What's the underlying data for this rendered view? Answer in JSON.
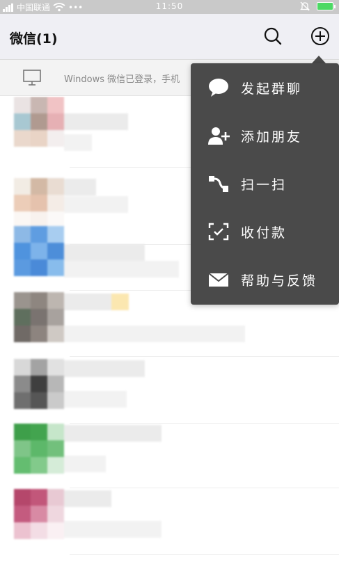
{
  "status_bar": {
    "carrier": "中国联通",
    "time": "11:50"
  },
  "header": {
    "title": "微信(1)"
  },
  "banner": {
    "text": "Windows 微信已登录，手机"
  },
  "menu": {
    "items": [
      {
        "label": "发起群聊",
        "icon": "chat-bubble-icon"
      },
      {
        "label": "添加朋友",
        "icon": "add-friend-icon"
      },
      {
        "label": "扫一扫",
        "icon": "scan-icon"
      },
      {
        "label": "收付款",
        "icon": "payment-icon"
      },
      {
        "label": "帮助与反馈",
        "icon": "mail-icon"
      }
    ]
  },
  "colors": {
    "menu_bg": "#4a4a4a",
    "header_bg": "#efeff4",
    "battery": "#4cd964"
  }
}
